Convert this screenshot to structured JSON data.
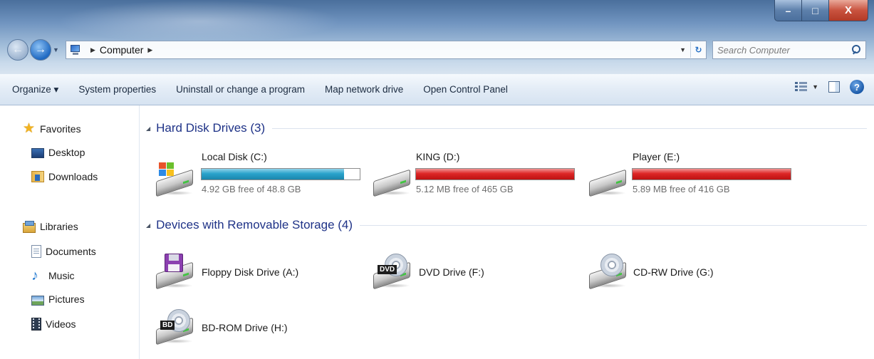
{
  "window": {
    "controls": {
      "minimize": "–",
      "maximize": "□",
      "close": "X"
    }
  },
  "address": {
    "back_icon": "back-arrow-icon",
    "forward_icon": "forward-arrow-icon",
    "crumbs": [
      "Computer"
    ],
    "search_placeholder": "Search Computer"
  },
  "toolbar": {
    "items": [
      "Organize ▾",
      "System properties",
      "Uninstall or change a program",
      "Map network drive",
      "Open Control Panel"
    ]
  },
  "navigation": {
    "favorites": {
      "label": "Favorites",
      "items": [
        "Desktop",
        "Downloads"
      ]
    },
    "libraries": {
      "label": "Libraries",
      "items": [
        "Documents",
        "Music",
        "Pictures",
        "Videos"
      ]
    }
  },
  "content": {
    "groups": [
      {
        "title": "Hard Disk Drives (3)",
        "drives": [
          {
            "name": "Local Disk (C:)",
            "free": "4.92 GB free of 48.8 GB",
            "used_fraction": 0.899,
            "status": "ok"
          },
          {
            "name": "KING (D:)",
            "free": "5.12 MB free of 465 GB",
            "used_fraction": 1.0,
            "status": "full"
          },
          {
            "name": "Player (E:)",
            "free": "5.89 MB free of 416 GB",
            "used_fraction": 1.0,
            "status": "full"
          }
        ]
      },
      {
        "title": "Devices with Removable Storage (4)",
        "drives": [
          {
            "name": "Floppy Disk Drive (A:)",
            "icon": "floppy-drive-icon"
          },
          {
            "name": "DVD Drive (F:)",
            "icon": "dvd-drive-icon",
            "badge": "DVD"
          },
          {
            "name": "CD-RW Drive (G:)",
            "icon": "cd-drive-icon"
          },
          {
            "name": "BD-ROM Drive (H:)",
            "icon": "bd-drive-icon",
            "badge": "BD"
          }
        ]
      }
    ]
  },
  "colors": {
    "bar_ok": "#2aa3cb",
    "bar_full": "#dd2626",
    "group_title": "#1e3287"
  }
}
